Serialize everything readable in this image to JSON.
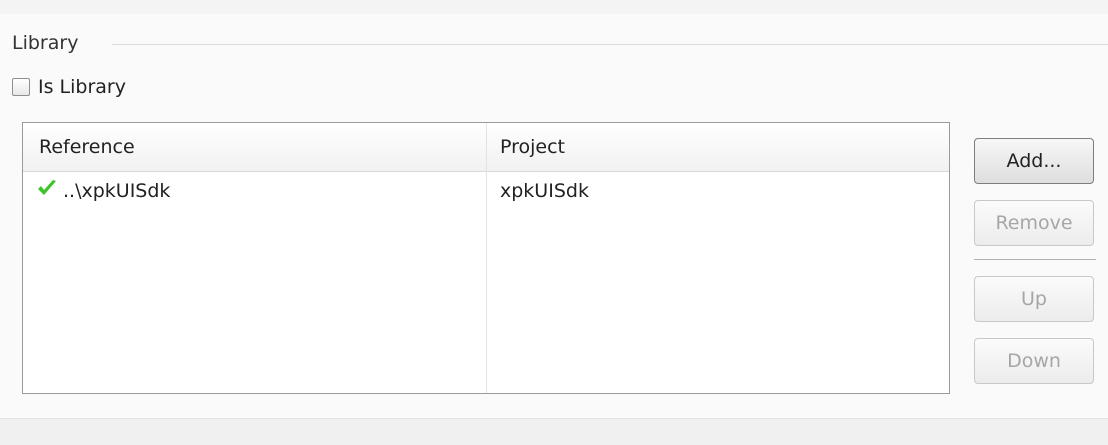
{
  "library": {
    "title": "Library",
    "is_library_label": "Is Library",
    "is_library_checked": false
  },
  "table": {
    "columns": [
      "Reference",
      "Project"
    ],
    "rows": [
      {
        "reference": "..\\xpkUISdk",
        "project": "xpkUISdk",
        "status_icon": "green-checkmark-icon"
      }
    ]
  },
  "buttons": {
    "add": "Add...",
    "remove": "Remove",
    "up": "Up",
    "down": "Down"
  },
  "colors": {
    "check_green": "#3cc428",
    "disabled_text": "#a6a6a6"
  }
}
